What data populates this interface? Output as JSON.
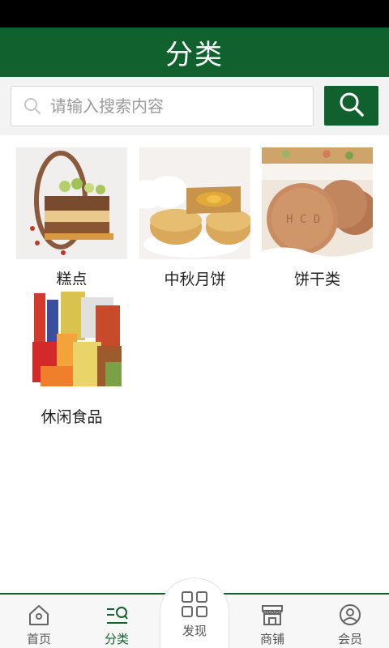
{
  "header": {
    "title": "分类"
  },
  "search": {
    "placeholder": "请输入搜索内容"
  },
  "categories": [
    {
      "label": "糕点"
    },
    {
      "label": "中秋月饼"
    },
    {
      "label": "饼干类"
    },
    {
      "label": "休闲食品"
    }
  ],
  "tabbar": {
    "home": "首页",
    "category": "分类",
    "discover": "发现",
    "shops": "商铺",
    "member": "会员"
  },
  "colors": {
    "brand": "#11612f",
    "status_bar": "#000000",
    "text": "#222222"
  },
  "icons": [
    "search-icon",
    "home-icon",
    "category-icon",
    "discover-icon",
    "shop-icon",
    "member-icon"
  ]
}
